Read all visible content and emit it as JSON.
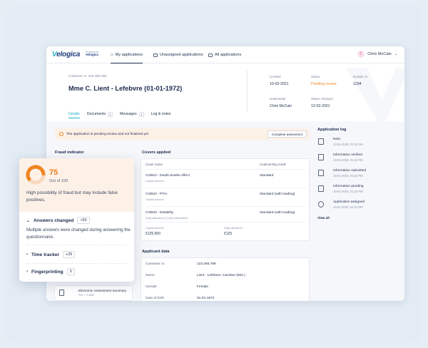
{
  "app": {
    "logo": "elogica",
    "logo_mark": "V",
    "powered_label": "Powered by",
    "powered_brand": "Velogica"
  },
  "nav": {
    "items": [
      {
        "label": "My applications",
        "active": true
      },
      {
        "label": "Unassigned applications",
        "active": false
      },
      {
        "label": "All applications",
        "active": false
      }
    ],
    "user": {
      "initial": "C",
      "name": "Chris McCain"
    }
  },
  "customer": {
    "label": "Customer nr. 123.456.789",
    "name": "Mme C. Lient - Lefebvre (01-01-1972)"
  },
  "meta": [
    {
      "label": "Created",
      "value": "10-02-2021",
      "orange": false
    },
    {
      "label": "Status",
      "value": "Pending review",
      "orange": true
    },
    {
      "label": "Dossier nr.",
      "value": "1234",
      "orange": false
    },
    {
      "label": "Underwriter",
      "value": "Chris McCain",
      "orange": false
    },
    {
      "label": "Status changed",
      "value": "12-02-2021",
      "orange": false
    }
  ],
  "tabs": [
    {
      "label": "Details",
      "badge": ""
    },
    {
      "label": "Documents",
      "badge": "1"
    },
    {
      "label": "Messages",
      "badge": "1"
    },
    {
      "label": "Log & notes",
      "badge": ""
    }
  ],
  "alert": {
    "text": "The application is pending review and not finalized yet",
    "button": "Complete assesment"
  },
  "fraud_indicator_label": "Fraud indicator",
  "covers": {
    "title": "Covers applied",
    "head_name": "Cover name",
    "head_result": "Underwriting result",
    "rows": [
      {
        "name": "COB10 - Death-double effect",
        "sub": "Capital amount",
        "result": "Standard"
      },
      {
        "name": "COB20 - PTIA",
        "sub": "Capital amount",
        "result": "Standard (with loading)"
      },
      {
        "name": "COB30 - Disability",
        "sub": "Daily allowance (2 days deductible)",
        "result": "Standard (with loading)"
      }
    ],
    "capital_label": "Capital amount",
    "capital_value": "€125.000",
    "daily_label": "Daily allowance",
    "daily_value": "€125"
  },
  "applicant": {
    "title": "Applicant data",
    "rows": [
      {
        "k": "Customer nr.",
        "v": "123.456.789"
      },
      {
        "k": "Name",
        "v": "Lient - Lefebvre, Caroline (Mrs.)"
      },
      {
        "k": "Gender",
        "v": "Female"
      },
      {
        "k": "Date of birth",
        "v": "01-01-1972"
      }
    ]
  },
  "log": {
    "title": "Application log",
    "items": [
      {
        "title": "Note",
        "date": "10-01-2020, 01:22 PM",
        "icon": "pencil-icon"
      },
      {
        "title": "Information verified",
        "date": "10-01-2020, 01:22 PM",
        "icon": "document-check-icon"
      },
      {
        "title": "Information submitted",
        "date": "10-01-2020, 01:22 PM",
        "icon": "document-upload-icon"
      },
      {
        "title": "Information pending",
        "date": "10-01-2020, 01:22 PM",
        "icon": "document-icon"
      },
      {
        "title": "Application assigned",
        "date": "10-01-2020, 01:22 PM",
        "icon": "user-assign-icon"
      }
    ],
    "view_all": "View all"
  },
  "document": {
    "title": "Electronic Assessment Summary",
    "sub": "PDF / 3.4MB"
  },
  "fraud": {
    "score": "75",
    "score_sub": "Out of 100",
    "score_fraction": 0.75,
    "description": "High possibility of fraud but may include false positives.",
    "sections": [
      {
        "title": "Answers changed",
        "badge": "+50",
        "expanded": true
      },
      {
        "title": "Time tracker",
        "badge": "+25",
        "expanded": false
      },
      {
        "title": "Fingerprinting",
        "badge": "0",
        "expanded": false
      }
    ],
    "answers_desc": "Multiple answers were changed during answering the questionnaire."
  },
  "colors": {
    "accent": "#1eb2c8",
    "brand": "#1e3a7b",
    "warning": "#f08a2b",
    "background": "#e6edf5"
  }
}
